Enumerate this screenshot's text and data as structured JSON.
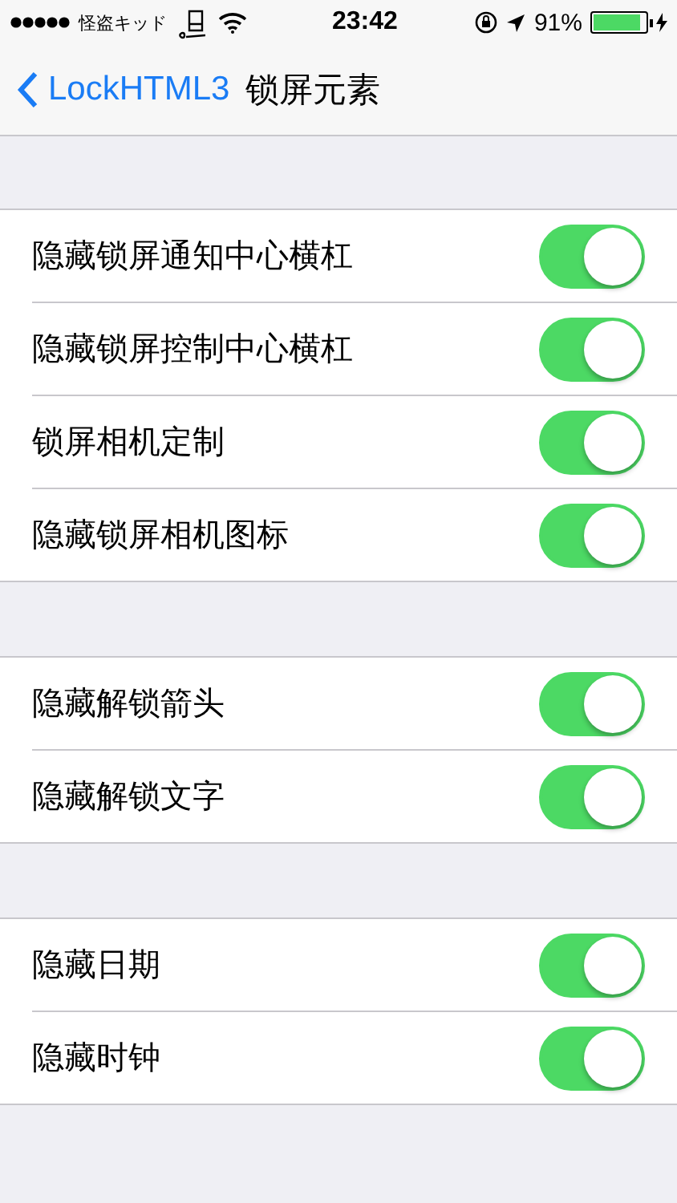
{
  "status_bar": {
    "carrier": "怪盗キッド",
    "time": "23:42",
    "battery": "91%"
  },
  "nav": {
    "back": "LockHTML3",
    "title": "锁屏元素"
  },
  "groups": [
    {
      "rows": [
        {
          "label": "隐藏锁屏通知中心横杠",
          "on": true
        },
        {
          "label": "隐藏锁屏控制中心横杠",
          "on": true
        },
        {
          "label": "锁屏相机定制",
          "on": true
        },
        {
          "label": "隐藏锁屏相机图标",
          "on": true
        }
      ]
    },
    {
      "rows": [
        {
          "label": "隐藏解锁箭头",
          "on": true
        },
        {
          "label": "隐藏解锁文字",
          "on": true
        }
      ]
    },
    {
      "rows": [
        {
          "label": "隐藏日期",
          "on": true
        },
        {
          "label": "隐藏时钟",
          "on": true
        }
      ]
    }
  ]
}
